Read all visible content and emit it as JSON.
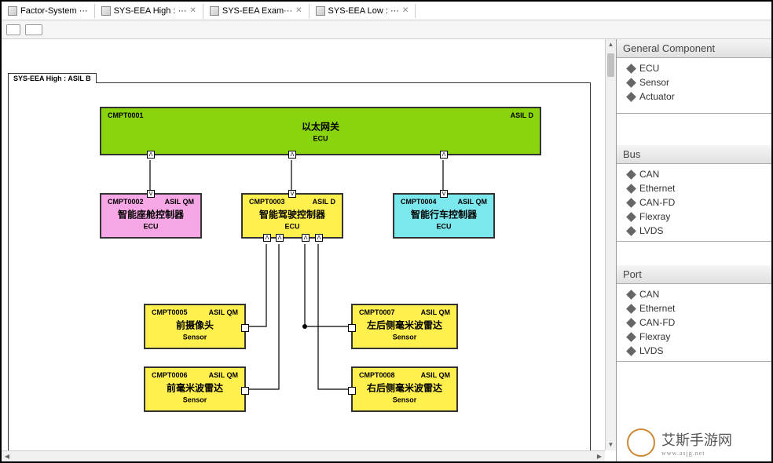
{
  "tabs": [
    {
      "label": "Factor-System ···",
      "active": false
    },
    {
      "label": "SYS-EEA High : ···",
      "close": "✕",
      "active": true
    },
    {
      "label": "SYS-EEA Exam···",
      "close": "✕",
      "active": false
    },
    {
      "label": "SYS-EEA Low : ···",
      "close": "✕",
      "active": false
    }
  ],
  "diagram": {
    "title": "SYS-EEA High : ASIL B",
    "nodes": {
      "n1": {
        "id": "CMPT0001",
        "asil": "ASIL D",
        "name": "以太网关",
        "kind": "ECU"
      },
      "n2": {
        "id": "CMPT0002",
        "asil": "ASIL QM",
        "name": "智能座舱控制器",
        "kind": "ECU"
      },
      "n3": {
        "id": "CMPT0003",
        "asil": "ASIL D",
        "name": "智能驾驶控制器",
        "kind": "ECU"
      },
      "n4": {
        "id": "CMPT0004",
        "asil": "ASIL QM",
        "name": "智能行车控制器",
        "kind": "ECU"
      },
      "n5": {
        "id": "CMPT0005",
        "asil": "ASIL QM",
        "name": "前摄像头",
        "kind": "Sensor"
      },
      "n6": {
        "id": "CMPT0006",
        "asil": "ASIL QM",
        "name": "前毫米波雷达",
        "kind": "Sensor"
      },
      "n7": {
        "id": "CMPT0007",
        "asil": "ASIL QM",
        "name": "左后侧毫米波雷达",
        "kind": "Sensor"
      },
      "n8": {
        "id": "CMPT0008",
        "asil": "ASIL QM",
        "name": "右后侧毫米波雷达",
        "kind": "Sensor"
      }
    }
  },
  "palette": {
    "sections": [
      {
        "title": "General Component",
        "items": [
          "ECU",
          "Sensor",
          "Actuator"
        ]
      },
      {
        "title": "Bus",
        "items": [
          "CAN",
          "Ethernet",
          "CAN-FD",
          "Flexray",
          "LVDS"
        ]
      },
      {
        "title": "Port",
        "items": [
          "CAN",
          "Ethernet",
          "CAN-FD",
          "Flexray",
          "LVDS"
        ]
      }
    ]
  },
  "watermark": {
    "text": "艾斯手游网",
    "sub": "www.asjg.net"
  },
  "port_glyph_up": "ᐱ",
  "port_glyph_down": "ᐯ"
}
